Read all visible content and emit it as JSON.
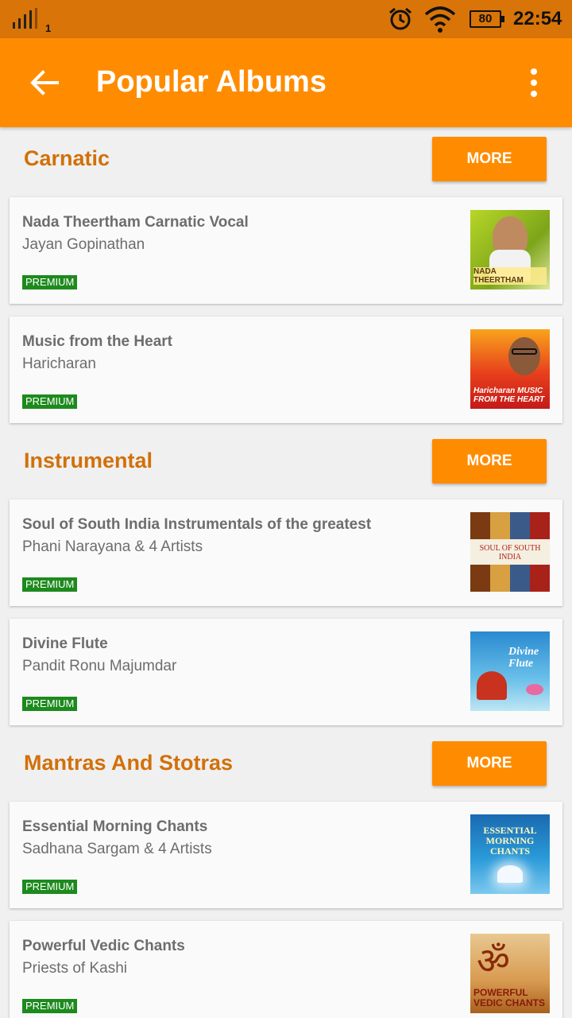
{
  "status_bar": {
    "sim": "1",
    "battery": "80",
    "time": "22:54"
  },
  "app_bar": {
    "title": "Popular Albums"
  },
  "sections": [
    {
      "title": "Carnatic",
      "more_label": "MORE",
      "albums": [
        {
          "title": "Nada Theertham   Carnatic Vocal",
          "artist": "Jayan Gopinathan",
          "badge": "PREMIUM",
          "art_text": "NADA THEERTHAM"
        },
        {
          "title": "Music from the Heart",
          "artist": "Haricharan",
          "badge": "PREMIUM",
          "art_text": "Haricharan MUSIC FROM THE HEART"
        }
      ]
    },
    {
      "title": "Instrumental",
      "more_label": "MORE",
      "albums": [
        {
          "title": "Soul of South India   Instrumentals of the greatest",
          "artist": "Phani Narayana & 4 Artists",
          "badge": "PREMIUM",
          "art_text": "SOUL OF SOUTH INDIA"
        },
        {
          "title": "Divine Flute",
          "artist": "Pandit Ronu Majumdar",
          "badge": "PREMIUM",
          "art_text": "Divine Flute"
        }
      ]
    },
    {
      "title": "Mantras And Stotras",
      "more_label": "MORE",
      "albums": [
        {
          "title": "Essential Morning Chants",
          "artist": "Sadhana Sargam & 4 Artists",
          "badge": "PREMIUM",
          "art_text": "ESSENTIAL MORNING CHANTS"
        },
        {
          "title": "Powerful Vedic Chants",
          "artist": "Priests of Kashi",
          "badge": "PREMIUM",
          "art_text": "POWERFUL VEDIC CHANTS"
        }
      ]
    }
  ]
}
